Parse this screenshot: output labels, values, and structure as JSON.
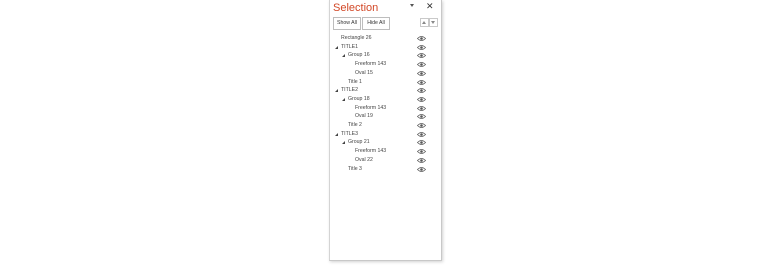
{
  "pane": {
    "title": "Selection",
    "show_all_label": "Show All",
    "hide_all_label": "Hide All",
    "close_glyph": "✕"
  },
  "items": [
    {
      "label": "Rectangle 26",
      "level": 0,
      "expander": false
    },
    {
      "label": "TITLE1",
      "level": 0,
      "expander": true
    },
    {
      "label": "Group 16",
      "level": 1,
      "expander": true
    },
    {
      "label": "Freeform 143",
      "level": 2,
      "expander": false
    },
    {
      "label": "Oval 15",
      "level": 2,
      "expander": false
    },
    {
      "label": "Title 1",
      "level": 1,
      "expander": false
    },
    {
      "label": "TITLE2",
      "level": 0,
      "expander": true
    },
    {
      "label": "Group 18",
      "level": 1,
      "expander": true
    },
    {
      "label": "Freeform 143",
      "level": 2,
      "expander": false
    },
    {
      "label": "Oval 19",
      "level": 2,
      "expander": false
    },
    {
      "label": "Title 2",
      "level": 1,
      "expander": false
    },
    {
      "label": "TITLE3",
      "level": 0,
      "expander": true
    },
    {
      "label": "Group 21",
      "level": 1,
      "expander": true
    },
    {
      "label": "Freeform 143",
      "level": 2,
      "expander": false
    },
    {
      "label": "Oval 22",
      "level": 2,
      "expander": false
    },
    {
      "label": "Title 3",
      "level": 1,
      "expander": false
    }
  ],
  "colors": {
    "title": "#d24726",
    "text": "#444444",
    "border": "#bdbdbd"
  }
}
